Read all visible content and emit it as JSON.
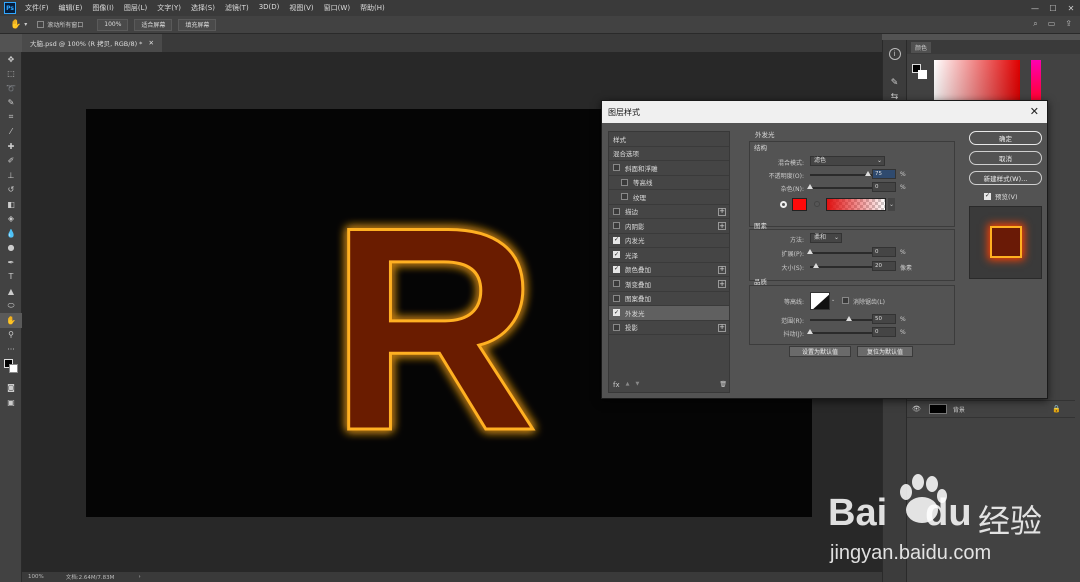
{
  "menubar": {
    "logo": "Ps",
    "items": [
      "文件(F)",
      "编辑(E)",
      "图像(I)",
      "图层(L)",
      "文字(Y)",
      "选择(S)",
      "滤镜(T)",
      "3D(D)",
      "视图(V)",
      "窗口(W)",
      "帮助(H)"
    ],
    "window_controls": [
      "—",
      "☐",
      "✕"
    ]
  },
  "options_bar": {
    "scroll_all_label": "滚动所有窗口",
    "zoom_value": "100%",
    "fit_screen": "适合屏幕",
    "fill_screen": "填充屏幕"
  },
  "document": {
    "tab_title": "大脑.psd @ 100% (R 拷贝, RGB/8) *",
    "canvas_letter": "R",
    "status_zoom": "100%",
    "status_doc": "文档:2.64M/7.83M"
  },
  "right_panel": {
    "color_tab": "颜色",
    "layer_name": "背景"
  },
  "dialog": {
    "title": "图层样式",
    "style_list": [
      {
        "label": "样式",
        "checkbox": false,
        "checked": false,
        "plus": false,
        "indent": 0
      },
      {
        "label": "混合选项",
        "checkbox": false,
        "checked": false,
        "plus": false,
        "indent": 0
      },
      {
        "label": "斜面和浮雕",
        "checkbox": true,
        "checked": false,
        "plus": false,
        "indent": 0
      },
      {
        "label": "等高线",
        "checkbox": true,
        "checked": false,
        "plus": false,
        "indent": 1
      },
      {
        "label": "纹理",
        "checkbox": true,
        "checked": false,
        "plus": false,
        "indent": 1
      },
      {
        "label": "描边",
        "checkbox": true,
        "checked": false,
        "plus": true,
        "indent": 0
      },
      {
        "label": "内阴影",
        "checkbox": true,
        "checked": false,
        "plus": true,
        "indent": 0
      },
      {
        "label": "内发光",
        "checkbox": true,
        "checked": true,
        "plus": false,
        "indent": 0
      },
      {
        "label": "光泽",
        "checkbox": true,
        "checked": true,
        "plus": false,
        "indent": 0
      },
      {
        "label": "颜色叠加",
        "checkbox": true,
        "checked": true,
        "plus": true,
        "indent": 0
      },
      {
        "label": "渐变叠加",
        "checkbox": true,
        "checked": false,
        "plus": true,
        "indent": 0
      },
      {
        "label": "图案叠加",
        "checkbox": true,
        "checked": false,
        "plus": false,
        "indent": 0
      },
      {
        "label": "外发光",
        "checkbox": true,
        "checked": true,
        "plus": false,
        "indent": 0,
        "selected": true
      },
      {
        "label": "投影",
        "checkbox": true,
        "checked": false,
        "plus": true,
        "indent": 0
      }
    ],
    "list_footer": {
      "fx": "fx",
      "up": "▲",
      "down": "▼",
      "trash": "🗑"
    },
    "section_title": "外发光",
    "structure": {
      "title": "结构",
      "blend_mode_label": "混合模式:",
      "blend_mode_value": "滤色",
      "opacity_label": "不透明度(O):",
      "opacity_value": "75",
      "noise_label": "杂色(N):",
      "noise_value": "0",
      "percent": "%"
    },
    "elements": {
      "title": "图素",
      "method_label": "方法:",
      "method_value": "柔和",
      "spread_label": "扩展(P):",
      "spread_value": "0",
      "size_label": "大小(S):",
      "size_value": "20",
      "px": "像素"
    },
    "quality": {
      "title": "品质",
      "contour_label": "等高线:",
      "antialias_label": "消除锯齿(L)",
      "range_label": "范围(R):",
      "range_value": "50",
      "jitter_label": "抖动(J):",
      "jitter_value": "0"
    },
    "levels": {
      "opacity": 0.75,
      "noise": 0,
      "spread": 0,
      "size": 0.08,
      "range": 0.5,
      "jitter": 0
    },
    "set_default": "设置为默认值",
    "reset_default": "复位为默认值",
    "buttons": {
      "ok": "确定",
      "cancel": "取消",
      "new_style": "新建样式(W)...",
      "preview": "预览(V)"
    },
    "colors": {
      "glow": "#ff0a0a",
      "gradient_start": "#e01010"
    }
  },
  "watermark": {
    "brand": "Bai",
    "brand2": "du",
    "cn": "经验",
    "url": "jingyan.baidu.com"
  }
}
